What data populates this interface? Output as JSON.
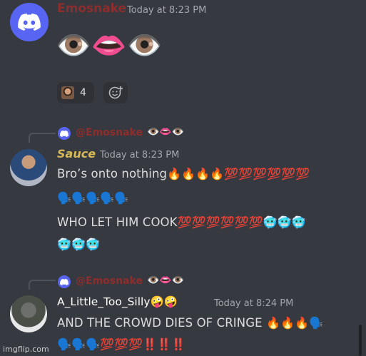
{
  "message1": {
    "author": "Emosnake",
    "author_color": "#8f2d2d",
    "timestamp": "Today at 8:23 PM",
    "content": "👁️👄👁️",
    "reactions": [
      {
        "icon": "custom-face-emoji",
        "count": "4"
      }
    ],
    "add_reaction_icon": "add-reaction-icon"
  },
  "reply1": {
    "replied_to": "@Emosnake",
    "replied_content": "👁️👄👁️"
  },
  "message2": {
    "author": "Sauce",
    "author_color": "#d4b85a",
    "timestamp": "Today at 8:23 PM",
    "line1_text": "Bro’s onto nothing",
    "line1_emojis": "🔥🔥🔥🔥💯💯💯💯💯💯",
    "line2_emojis": "🗣️🗣️🗣️🗣️🗣️",
    "line3_text": "WHO LET HIM COOK",
    "line3_emojis": "💯💯💯💯💯💯🥶🥶🥶",
    "line4_emojis": "🥶🥶🥶"
  },
  "reply2": {
    "replied_to": "@Emosnake",
    "replied_content": "👁️👄👁️"
  },
  "message3": {
    "author": "A_Little_Too_Silly",
    "author_suffix": "🤪🤪",
    "author_color": "#ffffff",
    "timestamp": "Today at 8:24 PM",
    "line1_text": "AND THE CROWD DIES OF CRINGE",
    "line1_emojis": "🔥🔥🔥🗣️",
    "line2_emojis": "🗣️🗣️🗣️💯💯💯‼️‼️‼️"
  },
  "watermark": "imgflip.com"
}
